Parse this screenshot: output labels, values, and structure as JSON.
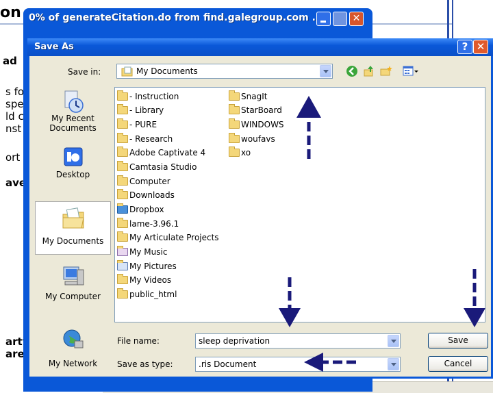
{
  "background": {
    "texts": [
      "on",
      "ad",
      "s fo",
      "spe",
      "ld c",
      "nst",
      "ort",
      "ave",
      "arty",
      "are:"
    ]
  },
  "progress_window": {
    "title": "0% of generateCitation.do from find.galegroup.com ...",
    "close_glyph": "✕"
  },
  "dialog": {
    "title": "Save As",
    "help_glyph": "?",
    "close_glyph": "✕",
    "save_in_label": "Save in:",
    "save_in_value": "My Documents",
    "places": [
      {
        "label": "My Recent Documents",
        "icon": "recent-documents-icon"
      },
      {
        "label": "Desktop",
        "icon": "desktop-icon"
      },
      {
        "label": "My Documents",
        "icon": "my-documents-icon",
        "selected": true
      },
      {
        "label": "My Computer",
        "icon": "my-computer-icon"
      },
      {
        "label": "My Network",
        "icon": "my-network-icon"
      }
    ],
    "files_col1": [
      "- Instruction",
      "- Library",
      "- PURE",
      "- Research",
      "Adobe Captivate 4",
      "Camtasia Studio",
      "Computer",
      "Downloads",
      "Dropbox",
      "lame-3.96.1",
      "My Articulate Projects",
      "My Music",
      "My Pictures",
      "My Videos",
      "public_html"
    ],
    "files_col2": [
      "SnagIt",
      "StarBoard",
      "WINDOWS",
      "woufavs",
      "xo"
    ],
    "file_name_label": "File name:",
    "file_name_value": "sleep deprivation",
    "save_as_type_label": "Save as type:",
    "save_as_type_value": ".ris Document",
    "save_button": "Save",
    "cancel_button": "Cancel"
  },
  "colors": {
    "title_blue": "#0a58d8",
    "annotation_arrow": "#1a1a7a",
    "dialog_face": "#ece9d8"
  }
}
